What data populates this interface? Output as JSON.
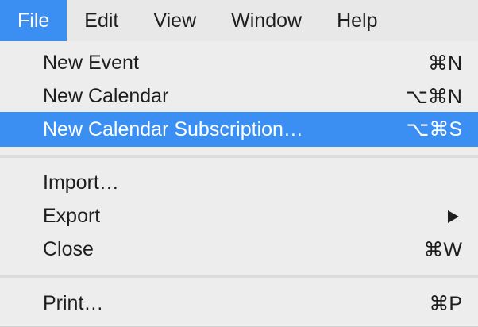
{
  "menubar": {
    "items": [
      {
        "label": "File",
        "active": true
      },
      {
        "label": "Edit",
        "active": false
      },
      {
        "label": "View",
        "active": false
      },
      {
        "label": "Window",
        "active": false
      },
      {
        "label": "Help",
        "active": false
      }
    ]
  },
  "file_menu": {
    "items": [
      {
        "label": "New Event",
        "shortcut": "⌘N"
      },
      {
        "label": "New Calendar",
        "shortcut": "⌥⌘N"
      },
      {
        "label": "New Calendar Subscription…",
        "shortcut": "⌥⌘S",
        "highlighted": true
      },
      {
        "label": "Import…",
        "shortcut": ""
      },
      {
        "label": "Export",
        "submenu": true,
        "submenu_icon": "triangle-right-icon"
      },
      {
        "label": "Close",
        "shortcut": "⌘W"
      },
      {
        "label": "Print…",
        "shortcut": "⌘P"
      }
    ]
  },
  "colors": {
    "highlight": "#3b8ff2",
    "menu_background": "#ededed",
    "menubar_background": "#e8e8e8"
  }
}
